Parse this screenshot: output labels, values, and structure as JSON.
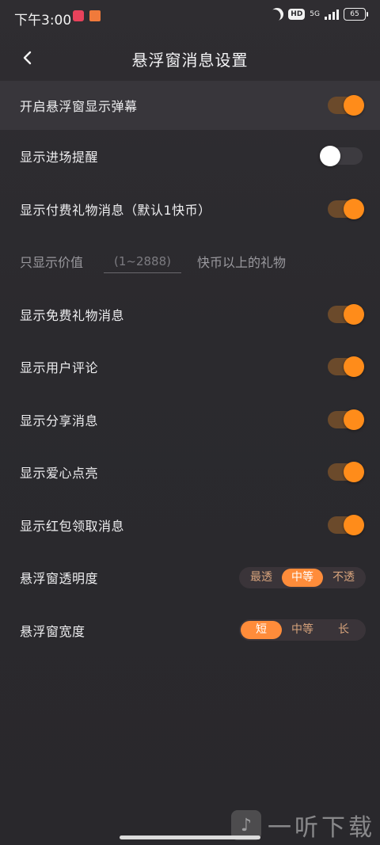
{
  "status": {
    "time": "下午3:00",
    "hd": "HD",
    "network": "5G",
    "battery": "65"
  },
  "header": {
    "title": "悬浮窗消息设置"
  },
  "settings": [
    {
      "label": "开启悬浮窗显示弹幕",
      "on": true
    },
    {
      "label": "显示进场提醒",
      "on": false
    },
    {
      "label": "显示付费礼物消息（默认1快币）",
      "on": true
    }
  ],
  "price_filter": {
    "prefix": "只显示价值",
    "placeholder": "(1~2888)",
    "suffix": "快币以上的礼物"
  },
  "settings2": [
    {
      "label": "显示免费礼物消息",
      "on": true
    },
    {
      "label": "显示用户评论",
      "on": true
    },
    {
      "label": "显示分享消息",
      "on": true
    },
    {
      "label": "显示爱心点亮",
      "on": true
    },
    {
      "label": "显示红包领取消息",
      "on": true
    }
  ],
  "opacity": {
    "label": "悬浮窗透明度",
    "options": [
      "最透",
      "中等",
      "不透"
    ],
    "selected": "中等"
  },
  "width": {
    "label": "悬浮窗宽度",
    "options": [
      "短",
      "中等",
      "长"
    ],
    "selected": "短"
  },
  "watermark": {
    "text": "一听下载"
  },
  "colors": {
    "accent": "#ff8c1a",
    "background": "#2b2a2e"
  }
}
